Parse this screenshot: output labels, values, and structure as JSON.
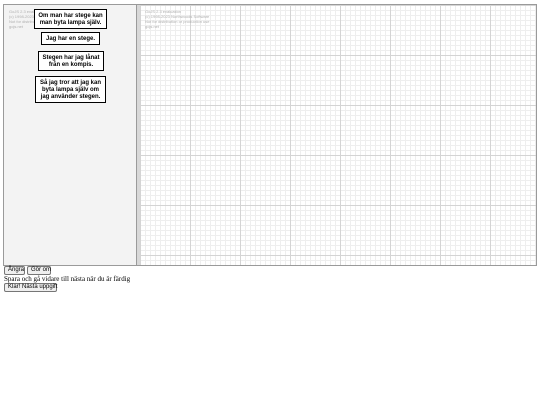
{
  "watermark": {
    "palette_lines": [
      "GoJS 2.3 evaluation",
      "(c) 1998-2023 Northwoods Software",
      "Not for distribution or production use",
      "gojs.net"
    ],
    "canvas_lines": [
      "GoJS 2.3 evaluation",
      "(c) 1998-2023 Northwoods Software",
      "Not for distribution or production use",
      "gojs.net"
    ]
  },
  "palette": {
    "shapes": [
      {
        "text": "Om man har stege kan\nman byta lampa själv."
      },
      {
        "text": "Jag har en stege."
      },
      {
        "text": "Stegen har jag lånat\nfrån en kompis."
      },
      {
        "text": "Så jag tror att jag kan\nbyta lampa själv om\njag använder stegen."
      }
    ]
  },
  "controls": {
    "undo_label": "Ångra",
    "redo_label": "Gör om",
    "instruction": "Spara och gå vidare till nästa när du är färdig",
    "done_label": "Klar! Nästa uppgift"
  }
}
